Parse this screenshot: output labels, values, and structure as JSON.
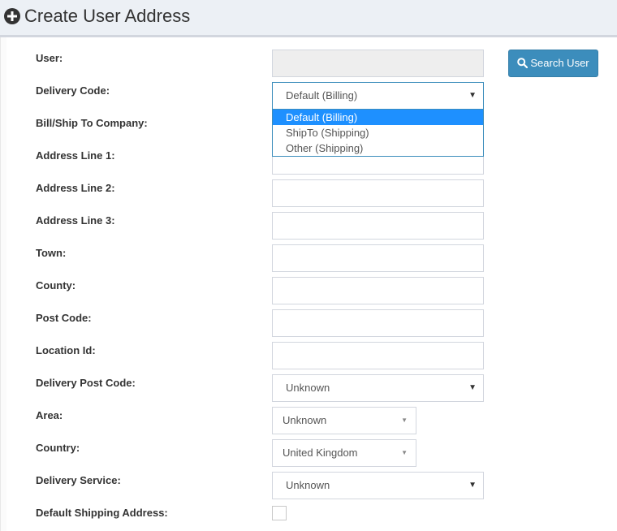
{
  "header": {
    "title": "Create User Address",
    "icon": "plus-circle-icon"
  },
  "labels": {
    "user": "User:",
    "delivery_code": "Delivery Code:",
    "company": "Bill/Ship To Company:",
    "address1": "Address Line 1:",
    "address2": "Address Line 2:",
    "address3": "Address Line 3:",
    "town": "Town:",
    "county": "County:",
    "post_code": "Post Code:",
    "location_id": "Location Id:",
    "delivery_post_code": "Delivery Post Code:",
    "area": "Area:",
    "country": "Country:",
    "delivery_service": "Delivery Service:",
    "default_shipping": "Default Shipping Address:"
  },
  "search_button": {
    "label": "Search User",
    "icon": "search-icon",
    "color": "#3c8dbc"
  },
  "delivery_code": {
    "selected": "Default (Billing)",
    "options": [
      "Default (Billing)",
      "ShipTo (Shipping)",
      "Other (Shipping)"
    ],
    "highlighted_index": 0
  },
  "selects": {
    "delivery_post_code": "Unknown",
    "area": "Unknown",
    "country": "United Kingdom",
    "delivery_service": "Unknown"
  },
  "default_shipping_checked": false
}
